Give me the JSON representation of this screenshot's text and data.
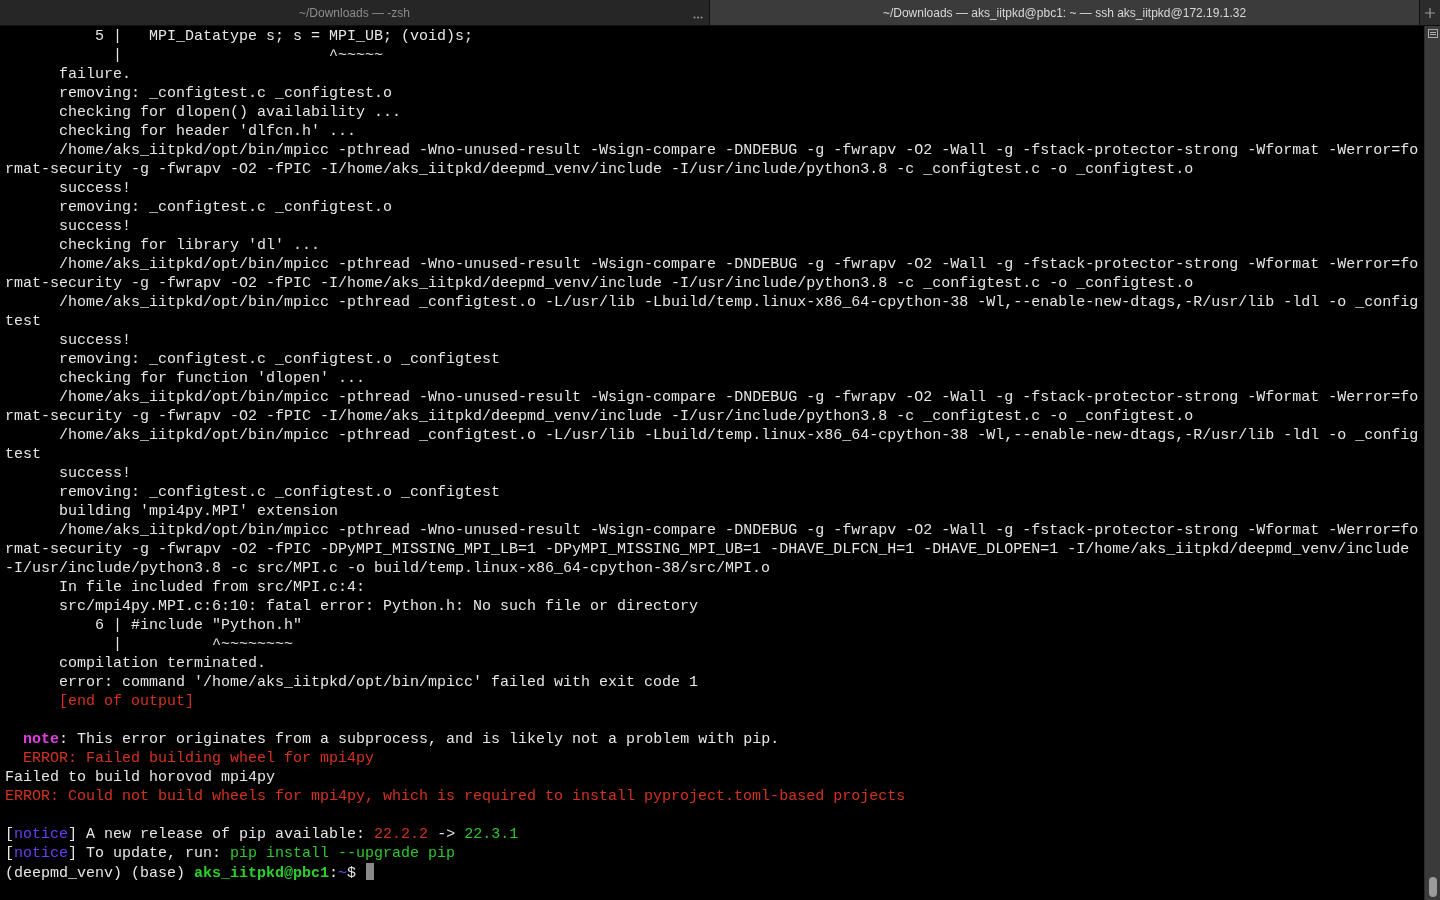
{
  "tabs": [
    {
      "title": "~/Downloads — -zsh",
      "selected": false
    },
    {
      "title": "~/Downloads — aks_iitpkd@pbc1: ~ — ssh aks_iitpkd@172.19.1.32",
      "selected": true
    }
  ],
  "lines": [
    {
      "kind": "text",
      "spans": [
        {
          "kind": "plain",
          "text": "          5 |   MPI_Datatype s; s = MPI_UB; (void)s;"
        }
      ]
    },
    {
      "kind": "text",
      "spans": [
        {
          "kind": "plain",
          "text": "            |                       ^~~~~~"
        }
      ]
    },
    {
      "kind": "text",
      "spans": [
        {
          "kind": "plain",
          "text": "      failure."
        }
      ]
    },
    {
      "kind": "text",
      "spans": [
        {
          "kind": "plain",
          "text": "      removing: _configtest.c _configtest.o"
        }
      ]
    },
    {
      "kind": "text",
      "spans": [
        {
          "kind": "plain",
          "text": "      checking for dlopen() availability ..."
        }
      ]
    },
    {
      "kind": "text",
      "spans": [
        {
          "kind": "plain",
          "text": "      checking for header 'dlfcn.h' ..."
        }
      ]
    },
    {
      "kind": "text",
      "spans": [
        {
          "kind": "plain",
          "text": "      /home/aks_iitpkd/opt/bin/mpicc -pthread -Wno-unused-result -Wsign-compare -DNDEBUG -g -fwrapv -O2 -Wall -g -fstack-protector-strong -Wformat -Werror=fo"
        }
      ]
    },
    {
      "kind": "text",
      "spans": [
        {
          "kind": "plain",
          "text": "rmat-security -g -fwrapv -O2 -fPIC -I/home/aks_iitpkd/deepmd_venv/include -I/usr/include/python3.8 -c _configtest.c -o _configtest.o"
        }
      ]
    },
    {
      "kind": "text",
      "spans": [
        {
          "kind": "plain",
          "text": "      success!"
        }
      ]
    },
    {
      "kind": "text",
      "spans": [
        {
          "kind": "plain",
          "text": "      removing: _configtest.c _configtest.o"
        }
      ]
    },
    {
      "kind": "text",
      "spans": [
        {
          "kind": "plain",
          "text": "      success!"
        }
      ]
    },
    {
      "kind": "text",
      "spans": [
        {
          "kind": "plain",
          "text": "      checking for library 'dl' ..."
        }
      ]
    },
    {
      "kind": "text",
      "spans": [
        {
          "kind": "plain",
          "text": "      /home/aks_iitpkd/opt/bin/mpicc -pthread -Wno-unused-result -Wsign-compare -DNDEBUG -g -fwrapv -O2 -Wall -g -fstack-protector-strong -Wformat -Werror=fo"
        }
      ]
    },
    {
      "kind": "text",
      "spans": [
        {
          "kind": "plain",
          "text": "rmat-security -g -fwrapv -O2 -fPIC -I/home/aks_iitpkd/deepmd_venv/include -I/usr/include/python3.8 -c _configtest.c -o _configtest.o"
        }
      ]
    },
    {
      "kind": "text",
      "spans": [
        {
          "kind": "plain",
          "text": "      /home/aks_iitpkd/opt/bin/mpicc -pthread _configtest.o -L/usr/lib -Lbuild/temp.linux-x86_64-cpython-38 -Wl,--enable-new-dtags,-R/usr/lib -ldl -o _config"
        }
      ]
    },
    {
      "kind": "text",
      "spans": [
        {
          "kind": "plain",
          "text": "test"
        }
      ]
    },
    {
      "kind": "text",
      "spans": [
        {
          "kind": "plain",
          "text": "      success!"
        }
      ]
    },
    {
      "kind": "text",
      "spans": [
        {
          "kind": "plain",
          "text": "      removing: _configtest.c _configtest.o _configtest"
        }
      ]
    },
    {
      "kind": "text",
      "spans": [
        {
          "kind": "plain",
          "text": "      checking for function 'dlopen' ..."
        }
      ]
    },
    {
      "kind": "text",
      "spans": [
        {
          "kind": "plain",
          "text": "      /home/aks_iitpkd/opt/bin/mpicc -pthread -Wno-unused-result -Wsign-compare -DNDEBUG -g -fwrapv -O2 -Wall -g -fstack-protector-strong -Wformat -Werror=fo"
        }
      ]
    },
    {
      "kind": "text",
      "spans": [
        {
          "kind": "plain",
          "text": "rmat-security -g -fwrapv -O2 -fPIC -I/home/aks_iitpkd/deepmd_venv/include -I/usr/include/python3.8 -c _configtest.c -o _configtest.o"
        }
      ]
    },
    {
      "kind": "text",
      "spans": [
        {
          "kind": "plain",
          "text": "      /home/aks_iitpkd/opt/bin/mpicc -pthread _configtest.o -L/usr/lib -Lbuild/temp.linux-x86_64-cpython-38 -Wl,--enable-new-dtags,-R/usr/lib -ldl -o _config"
        }
      ]
    },
    {
      "kind": "text",
      "spans": [
        {
          "kind": "plain",
          "text": "test"
        }
      ]
    },
    {
      "kind": "text",
      "spans": [
        {
          "kind": "plain",
          "text": "      success!"
        }
      ]
    },
    {
      "kind": "text",
      "spans": [
        {
          "kind": "plain",
          "text": "      removing: _configtest.c _configtest.o _configtest"
        }
      ]
    },
    {
      "kind": "text",
      "spans": [
        {
          "kind": "plain",
          "text": "      building 'mpi4py.MPI' extension"
        }
      ]
    },
    {
      "kind": "text",
      "spans": [
        {
          "kind": "plain",
          "text": "      /home/aks_iitpkd/opt/bin/mpicc -pthread -Wno-unused-result -Wsign-compare -DNDEBUG -g -fwrapv -O2 -Wall -g -fstack-protector-strong -Wformat -Werror=fo"
        }
      ]
    },
    {
      "kind": "text",
      "spans": [
        {
          "kind": "plain",
          "text": "rmat-security -g -fwrapv -O2 -fPIC -DPyMPI_MISSING_MPI_LB=1 -DPyMPI_MISSING_MPI_UB=1 -DHAVE_DLFCN_H=1 -DHAVE_DLOPEN=1 -I/home/aks_iitpkd/deepmd_venv/include"
        }
      ]
    },
    {
      "kind": "text",
      "spans": [
        {
          "kind": "plain",
          "text": "-I/usr/include/python3.8 -c src/MPI.c -o build/temp.linux-x86_64-cpython-38/src/MPI.o"
        }
      ]
    },
    {
      "kind": "text",
      "spans": [
        {
          "kind": "plain",
          "text": "      In file included from src/MPI.c:4:"
        }
      ]
    },
    {
      "kind": "text",
      "spans": [
        {
          "kind": "plain",
          "text": "      src/mpi4py.MPI.c:6:10: fatal error: Python.h: No such file or directory"
        }
      ]
    },
    {
      "kind": "text",
      "spans": [
        {
          "kind": "plain",
          "text": "          6 | #include \"Python.h\""
        }
      ]
    },
    {
      "kind": "text",
      "spans": [
        {
          "kind": "plain",
          "text": "            |          ^~~~~~~~~"
        }
      ]
    },
    {
      "kind": "text",
      "spans": [
        {
          "kind": "plain",
          "text": "      compilation terminated."
        }
      ]
    },
    {
      "kind": "text",
      "spans": [
        {
          "kind": "plain",
          "text": "      error: command '/home/aks_iitpkd/opt/bin/mpicc' failed with exit code 1"
        }
      ]
    },
    {
      "kind": "text",
      "spans": [
        {
          "kind": "error",
          "text": "      [end of output]"
        }
      ]
    },
    {
      "kind": "blank"
    },
    {
      "kind": "text",
      "spans": [
        {
          "kind": "keyword",
          "text": "  note"
        },
        {
          "kind": "plain",
          "text": ": This error originates from a subprocess, and is likely not a problem with pip."
        }
      ]
    },
    {
      "kind": "text",
      "spans": [
        {
          "kind": "error",
          "text": "  ERROR: Failed building wheel for mpi4py"
        }
      ]
    },
    {
      "kind": "text",
      "spans": [
        {
          "kind": "plain",
          "text": "Failed to build horovod mpi4py"
        }
      ]
    },
    {
      "kind": "text",
      "spans": [
        {
          "kind": "error",
          "text": "ERROR: Could not build wheels for mpi4py, which is required to install pyproject.toml-based projects"
        }
      ]
    },
    {
      "kind": "blank"
    },
    {
      "kind": "text",
      "spans": [
        {
          "kind": "plain",
          "text": "["
        },
        {
          "kind": "notice",
          "text": "notice"
        },
        {
          "kind": "plain",
          "text": "] A new release of pip available: "
        },
        {
          "kind": "error",
          "text": "22.2.2"
        },
        {
          "kind": "plain",
          "text": " -> "
        },
        {
          "kind": "success",
          "text": "22.3.1"
        }
      ]
    },
    {
      "kind": "text",
      "spans": [
        {
          "kind": "plain",
          "text": "["
        },
        {
          "kind": "notice",
          "text": "notice"
        },
        {
          "kind": "plain",
          "text": "] To update, run: "
        },
        {
          "kind": "success",
          "text": "pip install --upgrade pip"
        }
      ]
    },
    {
      "kind": "prompt",
      "spans": [
        {
          "kind": "plain",
          "text": "(deepmd_venv) (base) "
        },
        {
          "kind": "user",
          "text": "aks_iitpkd@pbc1"
        },
        {
          "kind": "plain",
          "text": ":"
        },
        {
          "kind": "path",
          "text": "~"
        },
        {
          "kind": "plain",
          "text": "$ "
        }
      ]
    }
  ]
}
